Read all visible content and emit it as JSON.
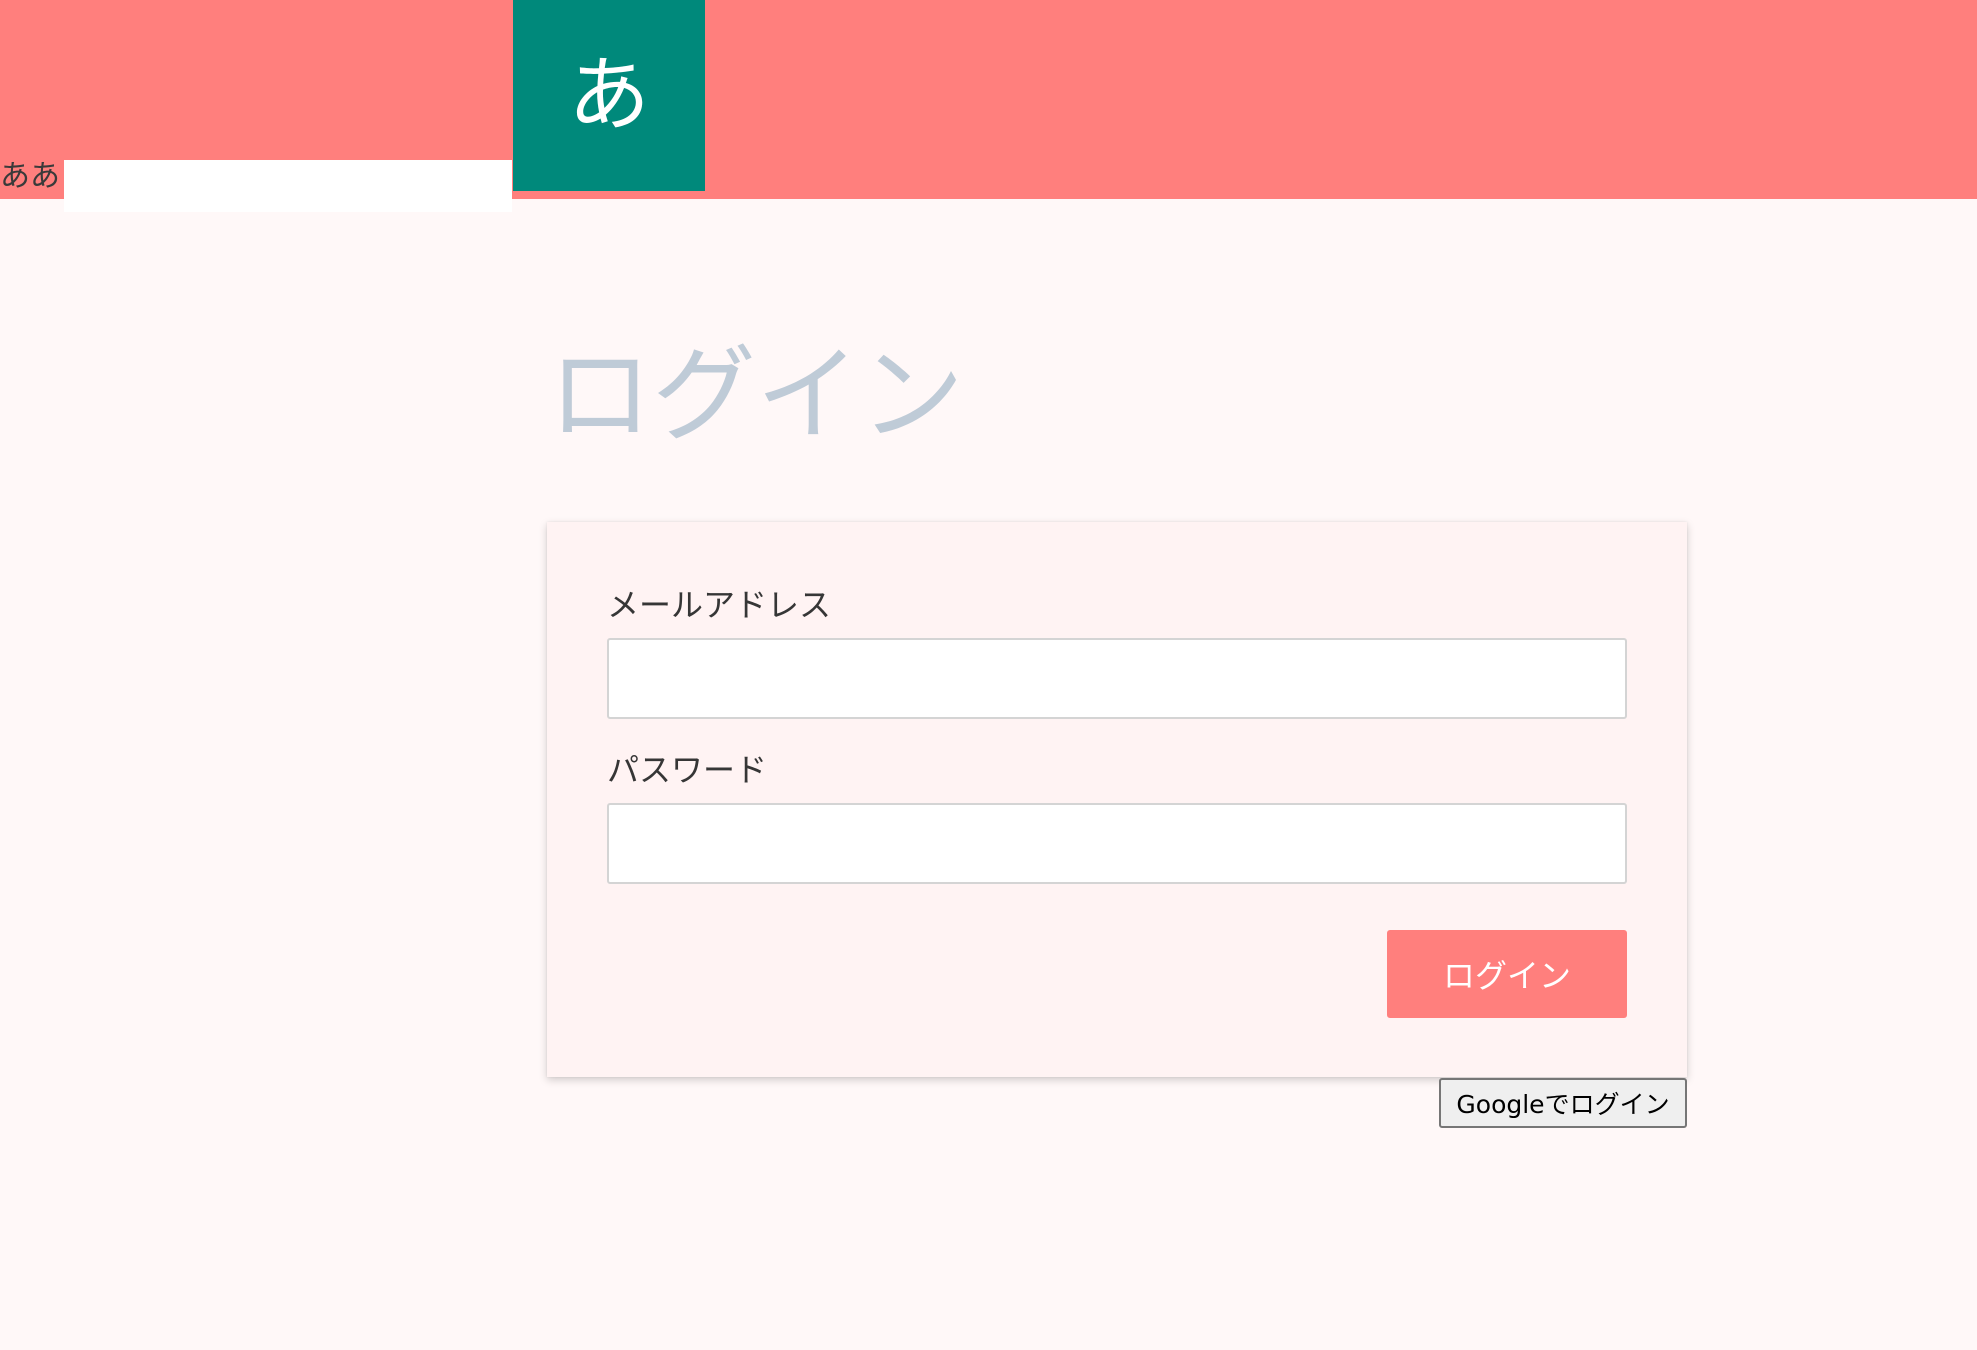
{
  "header": {
    "label": "ああ",
    "input_value": "",
    "logo_glyph": "あ",
    "background_color": "#ff7f7d",
    "logo_color": "#00897b"
  },
  "main": {
    "title": "ログイン"
  },
  "form": {
    "email_label": "メールアドレス",
    "email_value": "",
    "password_label": "パスワード",
    "password_value": "",
    "submit_label": "ログイン",
    "accent_color": "#ff7f7d"
  },
  "google_login_label": "Googleでログイン"
}
